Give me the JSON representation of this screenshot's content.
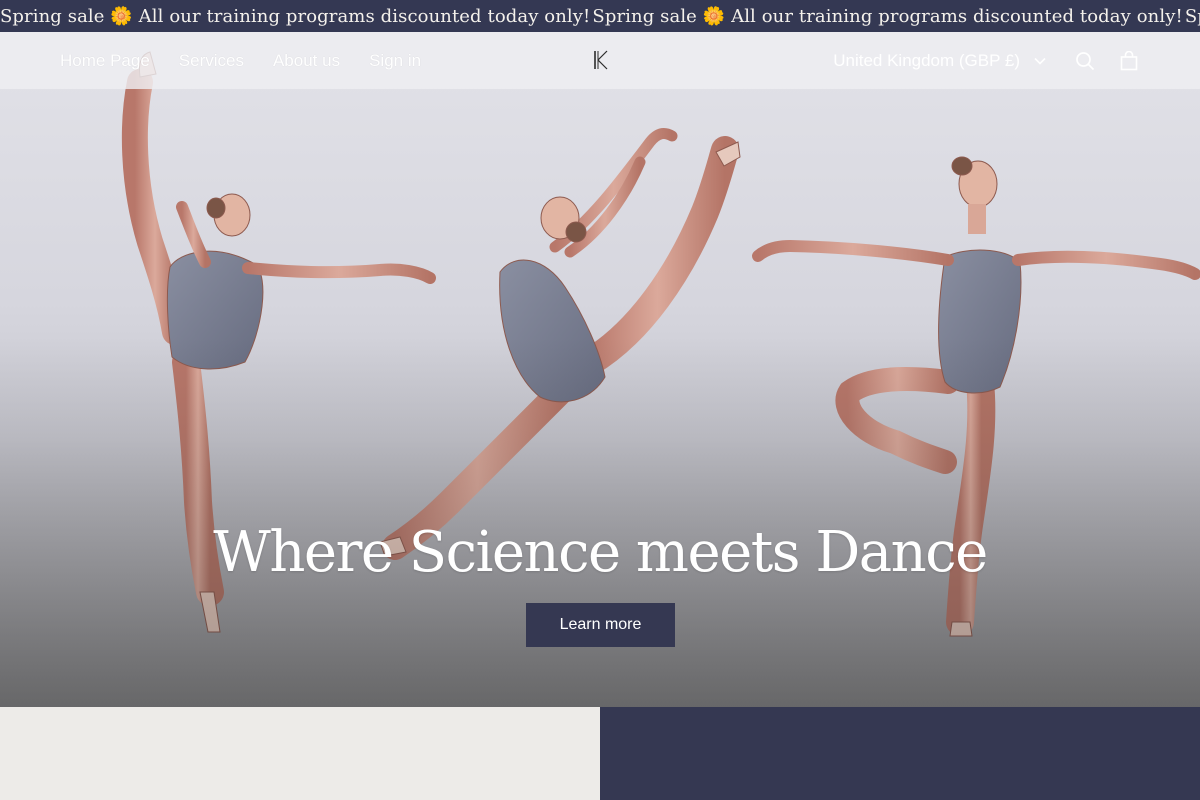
{
  "announcement": {
    "text": "Spring sale 🌼 All our training programs discounted today only! ",
    "flower_icon": "flower-icon"
  },
  "header": {
    "nav": [
      {
        "label": "Home Page"
      },
      {
        "label": "Services"
      },
      {
        "label": "About us"
      },
      {
        "label": "Sign in"
      }
    ],
    "logo_text": "K",
    "country_selector": "United Kingdom (GBP £)",
    "icons": [
      "chevron-down-icon",
      "search-icon",
      "cart-icon"
    ]
  },
  "hero": {
    "headline": "Where Science meets Dance",
    "cta_label": "Learn more"
  },
  "colors": {
    "brand_navy": "#343853",
    "panel_light": "#edebe8",
    "muscle": "#c98f80",
    "leotard": "#7d8294"
  }
}
